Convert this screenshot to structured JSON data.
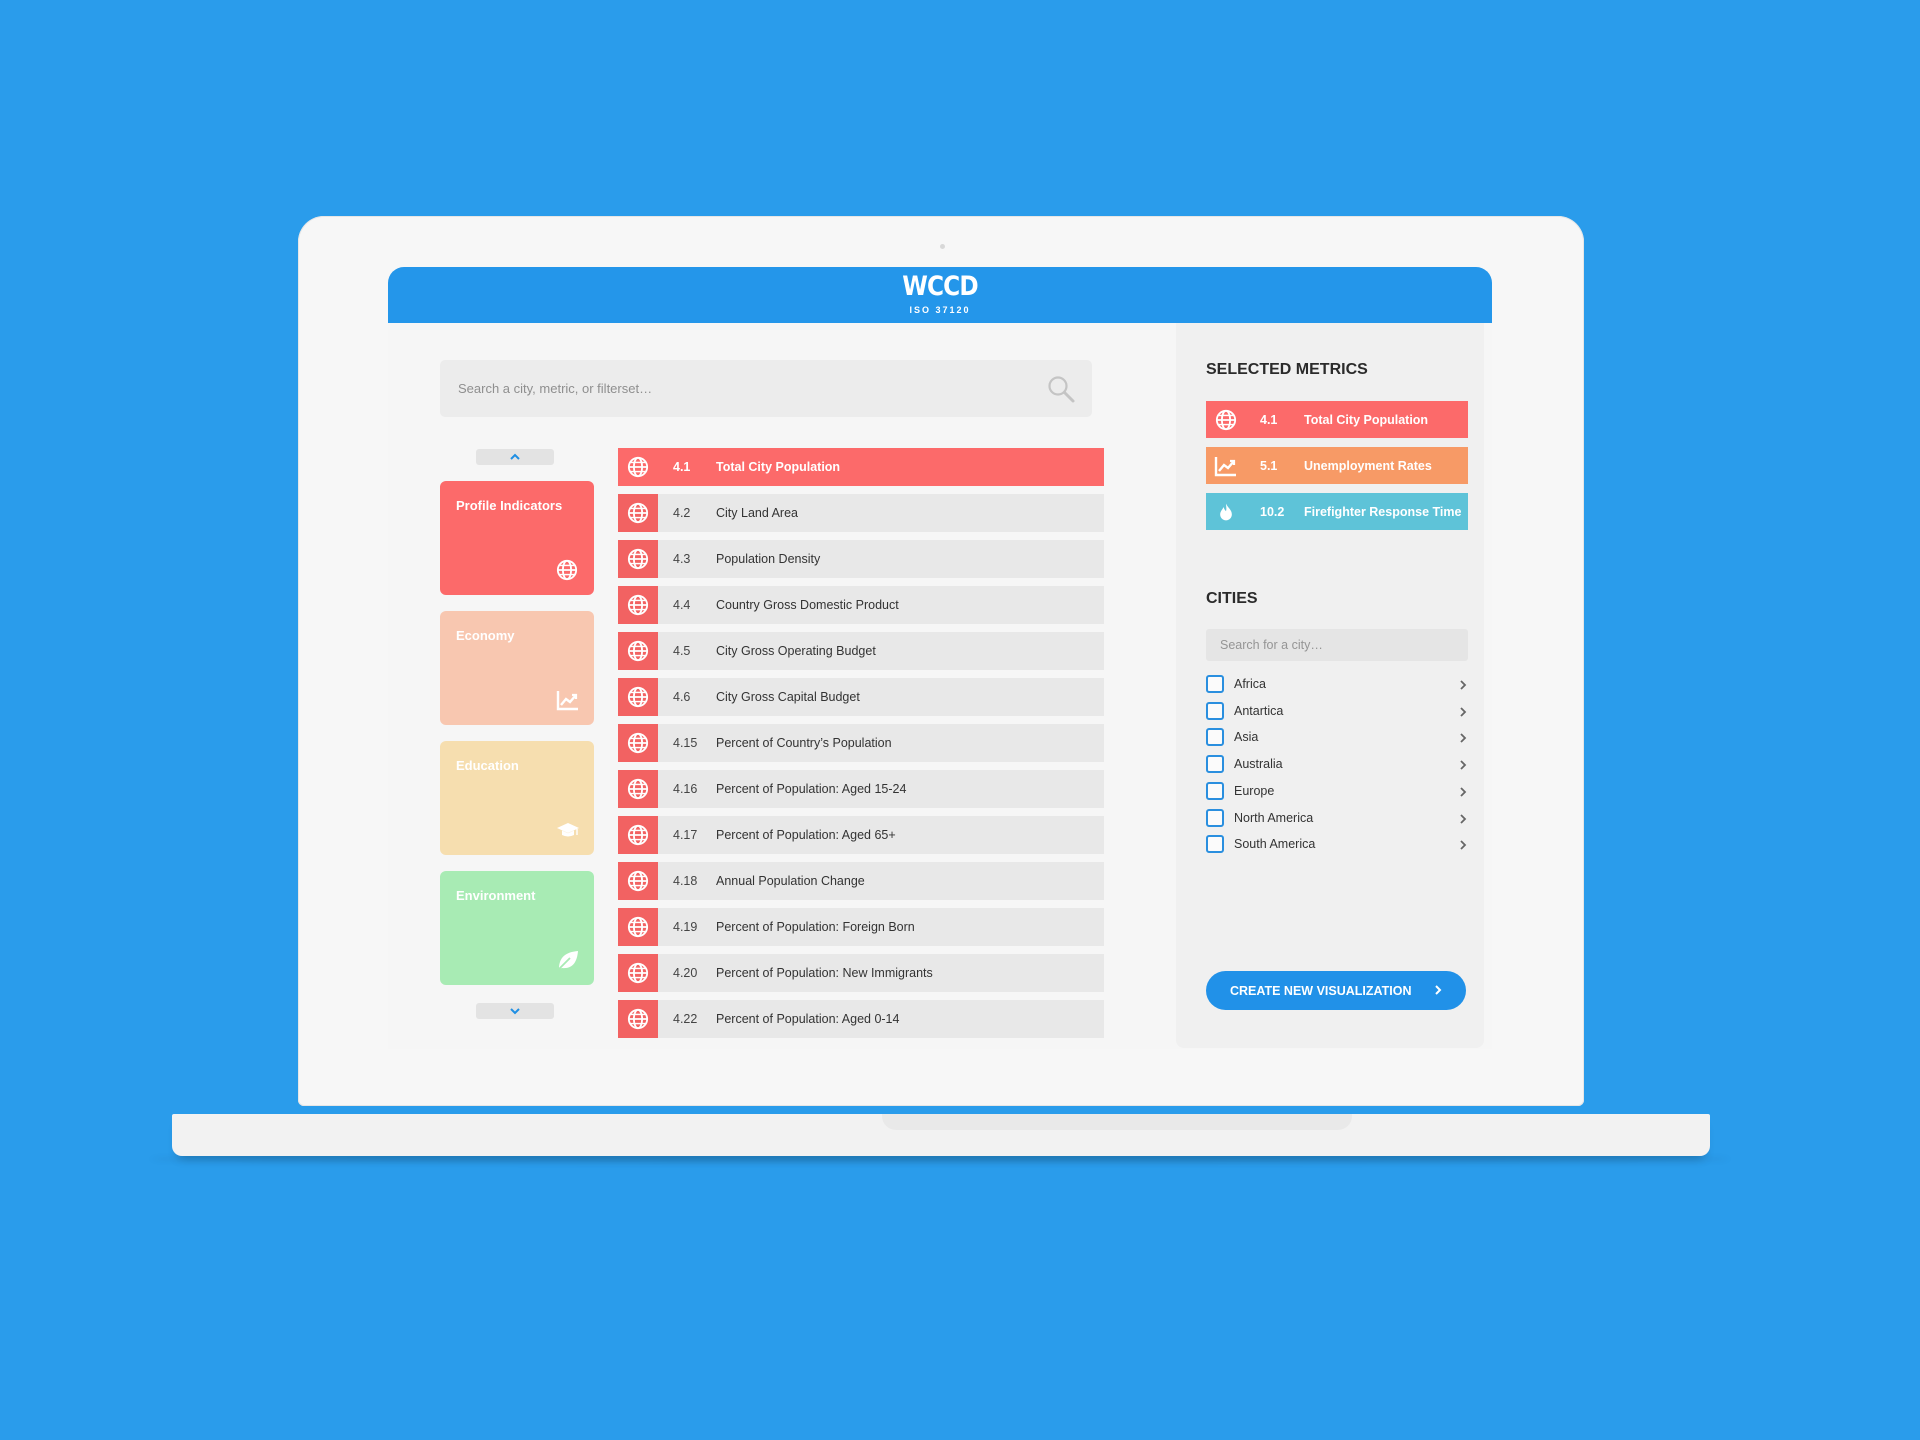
{
  "header": {
    "logo": "WCCD",
    "logo_sub": "ISO 37120"
  },
  "search": {
    "placeholder": "Search a city, metric, or filterset…"
  },
  "categories": [
    {
      "label": "Profile Indicators",
      "icon": "globe-icon",
      "color": "#fc6a6a"
    },
    {
      "label": "Economy",
      "icon": "line-chart-icon",
      "color": "#f8c7b0"
    },
    {
      "label": "Education",
      "icon": "graduation-cap-icon",
      "color": "#f6deaf"
    },
    {
      "label": "Environment",
      "icon": "leaf-icon",
      "color": "#a8ebb4"
    }
  ],
  "metrics": [
    {
      "num": "4.1",
      "name": "Total City Population",
      "active": true
    },
    {
      "num": "4.2",
      "name": "City Land Area"
    },
    {
      "num": "4.3",
      "name": "Population Density"
    },
    {
      "num": "4.4",
      "name": "Country Gross Domestic Product"
    },
    {
      "num": "4.5",
      "name": "City Gross Operating Budget"
    },
    {
      "num": "4.6",
      "name": "City Gross Capital Budget"
    },
    {
      "num": "4.15",
      "name": "Percent of Country’s Population"
    },
    {
      "num": "4.16",
      "name": "Percent of Population: Aged 15-24"
    },
    {
      "num": "4.17",
      "name": "Percent of Population: Aged 65+"
    },
    {
      "num": "4.18",
      "name": "Annual Population Change"
    },
    {
      "num": "4.19",
      "name": "Percent of Population: Foreign Born"
    },
    {
      "num": "4.20",
      "name": "Percent of Population: New Immigrants"
    },
    {
      "num": "4.22",
      "name": "Percent of Population: Aged 0-14"
    }
  ],
  "selected_metrics": {
    "heading": "SELECTED METRICS",
    "items": [
      {
        "num": "4.1",
        "name": "Total City Population",
        "icon": "globe-icon",
        "color": "#fc6a6a"
      },
      {
        "num": "5.1",
        "name": "Unemployment Rates",
        "icon": "line-chart-icon",
        "color": "#f79a66"
      },
      {
        "num": "10.2",
        "name": "Firefighter Response Time",
        "icon": "flame-icon",
        "color": "#5ec3d8"
      }
    ]
  },
  "cities": {
    "heading": "CITIES",
    "search_placeholder": "Search for a city…",
    "items": [
      "Africa",
      "Antartica",
      "Asia",
      "Australia",
      "Europe",
      "North America",
      "South America"
    ]
  },
  "create_button": {
    "label": "CREATE NEW VISUALIZATION"
  },
  "colors": {
    "brand_blue": "#2496ea",
    "background": "#2a9ceb"
  }
}
